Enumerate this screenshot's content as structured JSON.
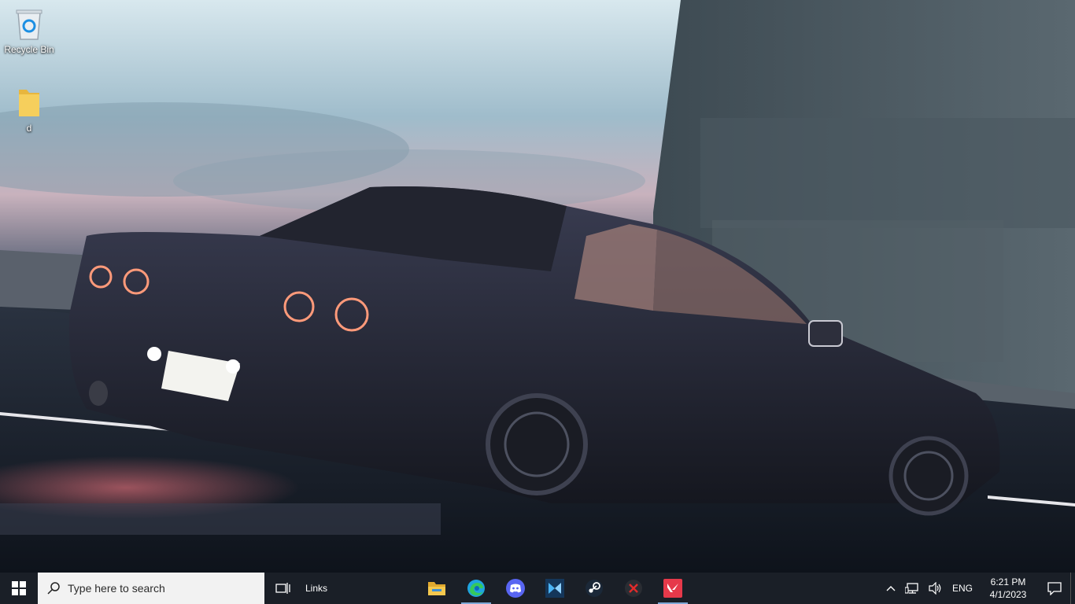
{
  "desktop": {
    "icons": [
      {
        "label": "Recycle Bin",
        "icon": "recycle-bin-icon"
      },
      {
        "label": "d",
        "icon": "folder-icon"
      }
    ]
  },
  "taskbar": {
    "search_placeholder": "Type here to search",
    "links_toolbar": "Links",
    "pinned": [
      {
        "name": "File Explorer",
        "icon": "file-explorer-icon",
        "running": false
      },
      {
        "name": "Microsoft Edge",
        "icon": "edge-icon",
        "running": true
      },
      {
        "name": "Discord",
        "icon": "discord-icon",
        "running": false
      },
      {
        "name": "Kodi-like app",
        "icon": "bracket-app-icon",
        "running": false
      },
      {
        "name": "Steam",
        "icon": "steam-icon",
        "running": false
      },
      {
        "name": "Close app",
        "icon": "red-x-app-icon",
        "running": false
      },
      {
        "name": "Valorant",
        "icon": "valorant-icon",
        "running": true
      }
    ],
    "tray": {
      "language": "ENG",
      "time": "6:21 PM",
      "date": "4/1/2023"
    }
  },
  "colors": {
    "taskbar_bg": "#1a1f27",
    "running_indicator": "#7ea9d6",
    "valorant_red": "#e6394a",
    "discord_blue": "#5865f2"
  }
}
